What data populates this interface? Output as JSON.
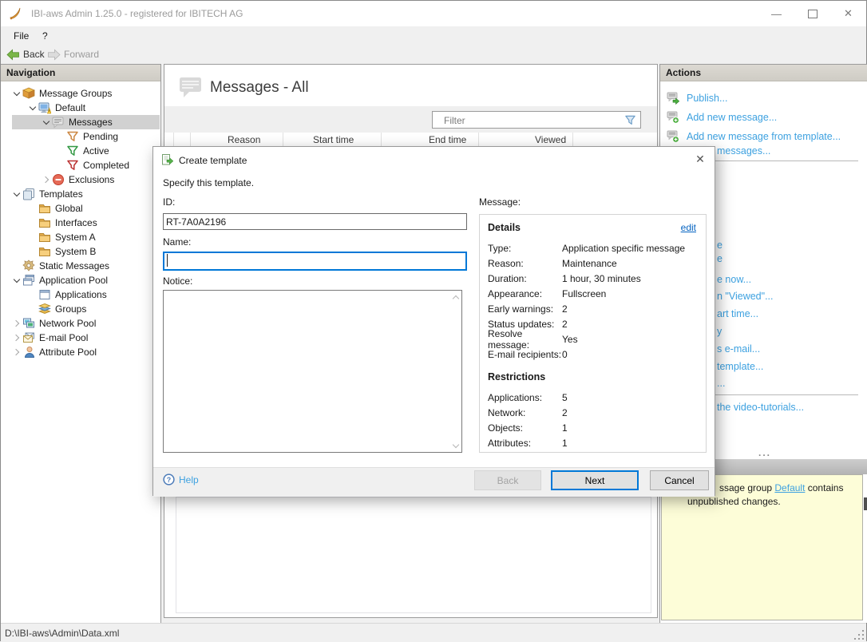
{
  "window": {
    "title": "IBI-aws Admin 1.25.0 - registered for IBITECH AG",
    "minimize_glyph": "—",
    "close_glyph": "✕"
  },
  "menu": {
    "file": "File",
    "help": "?"
  },
  "toolbar": {
    "back": "Back",
    "forward": "Forward"
  },
  "navigation": {
    "header": "Navigation",
    "items": [
      {
        "label": "Message Groups"
      },
      {
        "label": "Default"
      },
      {
        "label": "Messages"
      },
      {
        "label": "Pending"
      },
      {
        "label": "Active"
      },
      {
        "label": "Completed"
      },
      {
        "label": "Exclusions"
      },
      {
        "label": "Templates"
      },
      {
        "label": "Global"
      },
      {
        "label": "Interfaces"
      },
      {
        "label": "System A"
      },
      {
        "label": "System B"
      },
      {
        "label": "Static Messages"
      },
      {
        "label": "Application Pool"
      },
      {
        "label": "Applications"
      },
      {
        "label": "Groups"
      },
      {
        "label": "Network Pool"
      },
      {
        "label": "E-mail Pool"
      },
      {
        "label": "Attribute Pool"
      }
    ]
  },
  "main": {
    "title": "Messages - All",
    "filter_placeholder": "Filter",
    "columns": [
      "Reason",
      "Start time",
      "End time",
      "Viewed"
    ]
  },
  "actions": {
    "header": "Actions",
    "items": [
      "Publish...",
      "Add new message...",
      "Add new message from template..."
    ],
    "fragments": [
      "messages...",
      "e",
      "e",
      "e now...",
      "n \"Viewed\"...",
      "art time...",
      "y",
      "s e-mail...",
      "template...",
      "...",
      "the video-tutorials..."
    ],
    "overflow_dots": "..."
  },
  "notification": {
    "prefix": "ssage group ",
    "link": "Default",
    "suffix": " contains",
    "line2": "unpublished changes."
  },
  "dialog": {
    "title": "Create template",
    "close_glyph": "✕",
    "subtitle": "Specify this template.",
    "id_label": "ID:",
    "id_value": "RT-7A0A2196",
    "name_label": "Name:",
    "name_value": "",
    "notice_label": "Notice:",
    "notice_value": "",
    "message_label": "Message:",
    "details": {
      "heading": "Details",
      "edit_link": "edit",
      "rows": [
        {
          "label": "Type:",
          "value": "Application specific message"
        },
        {
          "label": "Reason:",
          "value": "Maintenance"
        },
        {
          "label": "Duration:",
          "value": "1 hour, 30 minutes"
        },
        {
          "label": "Appearance:",
          "value": "Fullscreen"
        },
        {
          "label": "Early warnings:",
          "value": "2"
        },
        {
          "label": "Status updates:",
          "value": "2"
        },
        {
          "label": "Resolve message:",
          "value": "Yes"
        },
        {
          "label": "E-mail recipients:",
          "value": "0"
        }
      ]
    },
    "restrictions": {
      "heading": "Restrictions",
      "rows": [
        {
          "label": "Applications:",
          "value": "5"
        },
        {
          "label": "Network:",
          "value": "2"
        },
        {
          "label": "Objects:",
          "value": "1"
        },
        {
          "label": "Attributes:",
          "value": "1"
        }
      ]
    },
    "footer": {
      "help": "Help",
      "back": "Back",
      "next": "Next",
      "cancel": "Cancel"
    }
  },
  "statusbar": {
    "path": "D:\\IBI-aws\\Admin\\Data.xml"
  },
  "colors": {
    "accent_blue": "#0078d7",
    "link_blue": "#3da1e0",
    "edit_link_blue": "#0563c1",
    "notification_bg": "#fdfdd8",
    "selected_row": "#d1d1d1"
  }
}
